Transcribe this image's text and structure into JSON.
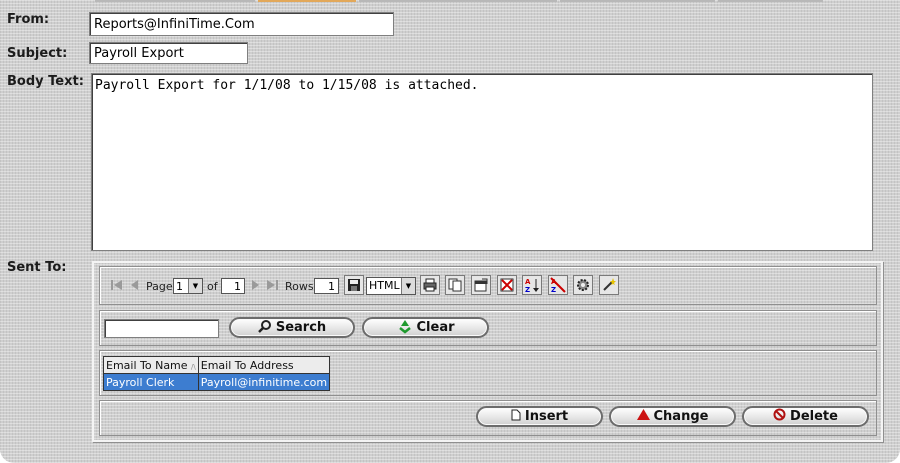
{
  "labels": {
    "from": "From:",
    "subject": "Subject:",
    "body_text": "Body Text:",
    "sent_to": "Sent To:"
  },
  "fields": {
    "from": "Reports@InfiniTime.Com",
    "subject": "Payroll Export",
    "body": "Payroll Export for 1/1/08 to 1/15/08 is attached."
  },
  "pager": {
    "page_label": "Page",
    "page_value": "1",
    "of_label": "of",
    "of_value": "1",
    "rows_label": "Rows",
    "rows_value": "1",
    "format_value": "HTML"
  },
  "search": {
    "search_value": "",
    "search_button": "Search",
    "clear_button": "Clear"
  },
  "table": {
    "headers": [
      "Email To Name",
      "Email To Address"
    ],
    "sort_indicator": "/\\",
    "rows": [
      [
        "Payroll Clerk",
        "Payroll@infinitime.com"
      ]
    ]
  },
  "actions": {
    "insert": "Insert",
    "change": "Change",
    "delete": "Delete"
  },
  "colors": {
    "panel_bg": "#cfcfcf",
    "selected_row": "#3d7dd0",
    "active_tab": "#e2a85a"
  }
}
